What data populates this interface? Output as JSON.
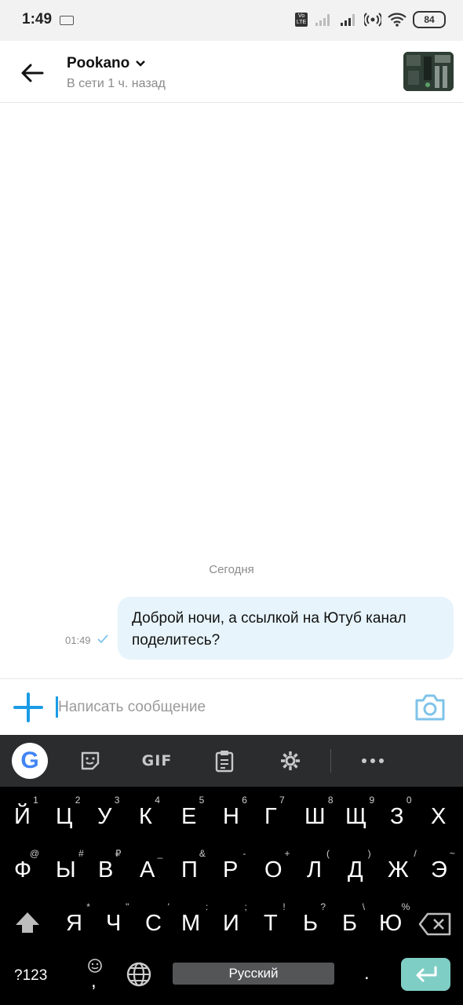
{
  "status_bar": {
    "time": "1:49",
    "volte": "Vo LTE",
    "battery": "84"
  },
  "header": {
    "contact_name": "Pookano",
    "contact_status": "В сети 1 ч. назад"
  },
  "chat": {
    "day_separator": "Сегодня",
    "messages": [
      {
        "text": "Доброй ночи, а ссылкой на Ютуб канал поделитесь?",
        "time": "01:49",
        "direction": "outgoing",
        "status": "sent"
      }
    ]
  },
  "composer": {
    "placeholder": "Написать сообщение"
  },
  "keyboard_toolbar": {
    "items": [
      "google-icon",
      "sticker-icon",
      "gif",
      "clipboard-icon",
      "gear-icon",
      "more-icon"
    ],
    "gif_label": "GIF"
  },
  "keyboard": {
    "row1": [
      {
        "key": "Й",
        "sup": "1"
      },
      {
        "key": "Ц",
        "sup": "2"
      },
      {
        "key": "У",
        "sup": "3"
      },
      {
        "key": "К",
        "sup": "4"
      },
      {
        "key": "Е",
        "sup": "5"
      },
      {
        "key": "Н",
        "sup": "6"
      },
      {
        "key": "Г",
        "sup": "7"
      },
      {
        "key": "Ш",
        "sup": "8"
      },
      {
        "key": "Щ",
        "sup": "9"
      },
      {
        "key": "З",
        "sup": "0"
      },
      {
        "key": "Х",
        "sup": ""
      }
    ],
    "row2": [
      {
        "key": "Ф",
        "sup": "@"
      },
      {
        "key": "Ы",
        "sup": "#"
      },
      {
        "key": "В",
        "sup": "₽"
      },
      {
        "key": "А",
        "sup": "_"
      },
      {
        "key": "П",
        "sup": "&"
      },
      {
        "key": "Р",
        "sup": "-"
      },
      {
        "key": "О",
        "sup": "+"
      },
      {
        "key": "Л",
        "sup": "("
      },
      {
        "key": "Д",
        "sup": ")"
      },
      {
        "key": "Ж",
        "sup": "/"
      },
      {
        "key": "Э",
        "sup": "~"
      }
    ],
    "row3": [
      {
        "key": "Я",
        "sup": "*"
      },
      {
        "key": "Ч",
        "sup": "\""
      },
      {
        "key": "С",
        "sup": "'"
      },
      {
        "key": "М",
        "sup": ":"
      },
      {
        "key": "И",
        "sup": ";"
      },
      {
        "key": "Т",
        "sup": "!"
      },
      {
        "key": "Ь",
        "sup": "?"
      },
      {
        "key": "Б",
        "sup": "\\"
      },
      {
        "key": "Ю",
        "sup": "%"
      }
    ],
    "symbols_label": "?123",
    "comma": ",",
    "space_label": "Русский",
    "period": "."
  },
  "colors": {
    "accent": "#1a9be6",
    "bubble_out": "#e7f4fb",
    "keyboard_bg": "#000000",
    "toolbar_bg": "#2b2c2e",
    "enter_key": "#7fcec5"
  }
}
